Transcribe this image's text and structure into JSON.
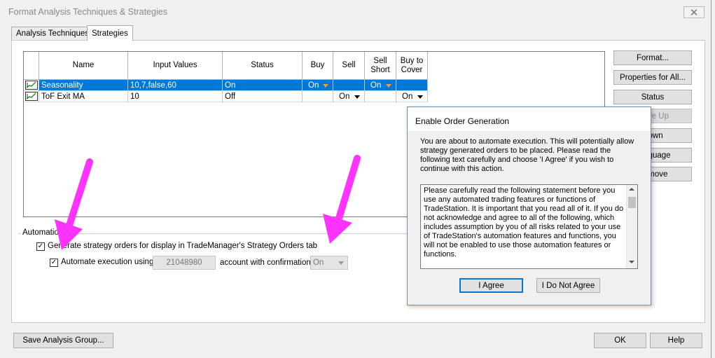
{
  "window": {
    "title": "Format Analysis Techniques & Strategies",
    "close_glyph": "✕"
  },
  "tabs": [
    {
      "label": "Analysis Techniques"
    },
    {
      "label": "Strategies"
    }
  ],
  "grid": {
    "headers": [
      "Name",
      "Input Values",
      "Status",
      "Buy",
      "Sell",
      "Sell\nShort",
      "Buy to\nCover"
    ],
    "rows": [
      {
        "name": "Seasonality",
        "inputs": "10,7,false,60",
        "status": "On",
        "buy": "On",
        "sell": "",
        "sell_short": "On",
        "buy_to_cover": ""
      },
      {
        "name": "ToF Exit MA",
        "inputs": "10",
        "status": "Off",
        "buy": "",
        "sell": "On",
        "sell_short": "",
        "buy_to_cover": "On"
      }
    ]
  },
  "side_buttons": [
    "Format...",
    "Properties for All...",
    "Status",
    "Move Up",
    "Down",
    "Language",
    "Remove"
  ],
  "automation": {
    "group_label": "Automation",
    "generate_label": "Generate strategy orders for display in TradeManager's Strategy Orders tab",
    "automate_label": "Automate execution using",
    "account": "21048980",
    "confirmation_label": "account with confirmation",
    "confirmation_value": "On",
    "check_glyph": "✓"
  },
  "bottom_buttons": {
    "save": "Save Analysis Group...",
    "ok": "OK",
    "help": "Help"
  },
  "dialog": {
    "title": "Enable Order Generation",
    "message": "You are about to automate execution.  This will potentially allow strategy generated orders to be placed.  Please read the following text carefully and choose 'I Agree' if you wish to continue with this action.",
    "statement": "Please carefully read the following statement before you use any automated trading features or functions of TradeStation.  It is important that you read all of it.  If you do not acknowledge and agree to all of the following, which includes assumption by you of all risks related to your use of TradeStation's automation features and functions, you will not be enabled to use those automation features or functions.",
    "agree": "I Agree",
    "disagree": "I Do Not Agree"
  },
  "colors": {
    "selection": "#0078d7",
    "annotation_arrow": "#ff33ff",
    "dropdown_arrow_selected": "#ff9933"
  }
}
